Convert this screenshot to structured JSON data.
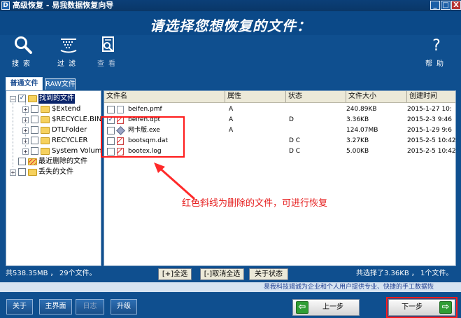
{
  "window": {
    "title": "高级恢复 - 易我数据恢复向导",
    "logo_glyph": "D",
    "min": "_",
    "max": "□",
    "close": "X"
  },
  "header": {
    "prompt": "请选择您想恢复的文件："
  },
  "toolbar": {
    "search": {
      "label": "搜索",
      "icon": "search-icon"
    },
    "filter": {
      "label": "过滤",
      "icon": "filter-icon"
    },
    "view": {
      "label": "查看",
      "icon": "view-icon"
    },
    "help": {
      "label": "帮助",
      "icon": "help-icon"
    }
  },
  "tabs": {
    "normal": "普通文件",
    "raw": "RAW文件"
  },
  "tree": {
    "root": {
      "label": "找到的文件",
      "checked": true
    },
    "children": [
      {
        "label": "$Extend"
      },
      {
        "label": "$RECYCLE.BIN"
      },
      {
        "label": "DTLFolder"
      },
      {
        "label": "RECYCLER"
      },
      {
        "label": "System Volume"
      }
    ],
    "recent_deleted": "最近删除的文件",
    "lost": "丢失的文件"
  },
  "table": {
    "columns": {
      "name": "文件名",
      "attr": "属性",
      "status": "状态",
      "size": "文件大小",
      "created": "创建时间"
    },
    "rows": [
      {
        "name": "beifen.pmf",
        "attr": "A",
        "status": "",
        "size": "240.89KB",
        "created": "2015-1-27 10:",
        "checked": false,
        "icon": "file-icon"
      },
      {
        "name": "beifen.dpt",
        "attr": "A",
        "status": "D",
        "size": "3.36KB",
        "created": "2015-2-3 9:46",
        "checked": true,
        "icon": "deleted-file-icon"
      },
      {
        "name": "网卡版.exe",
        "attr": "A",
        "status": "",
        "size": "124.07MB",
        "created": "2015-1-29 9:6",
        "checked": false,
        "icon": "exe-file-icon"
      },
      {
        "name": "bootsqm.dat",
        "attr": "",
        "status": "D C",
        "size": "3.27KB",
        "created": "2015-2-5 10:42",
        "checked": false,
        "icon": "deleted-file-icon"
      },
      {
        "name": "bootex.log",
        "attr": "",
        "status": "D C",
        "size": "5.00KB",
        "created": "2015-2-5 10:42",
        "checked": false,
        "icon": "deleted-file-icon"
      }
    ]
  },
  "annotation": {
    "note": "红色斜线为删除的文件，可进行恢复"
  },
  "status": {
    "total": "共538.35MB ， 29个文件。",
    "selected": "共选择了3.36KB ， 1个文件。",
    "select_all": "[+]全选",
    "unselect_all": "[-]取消全选",
    "about_status": "关于状态"
  },
  "ticker": {
    "text": "易我科技竭诚为企业和个人用户提供专业、快捷的手工数据恢"
  },
  "bottom": {
    "about": "关于",
    "main": "主界面",
    "log": "日志",
    "upgrade": "升级",
    "prev": "上一步",
    "next": "下一步"
  },
  "colors": {
    "background": "#0f4f8f",
    "highlight": "#ff1a1a",
    "ticker_bg": "#d6e3f1",
    "accent_green": "#2f9d34"
  }
}
